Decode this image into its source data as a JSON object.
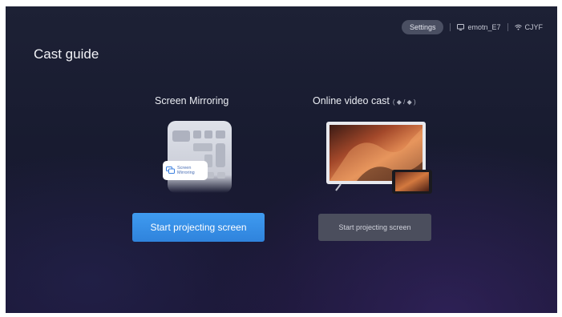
{
  "page": {
    "title": "Cast guide"
  },
  "topbar": {
    "settings_label": "Settings",
    "device_name": "emotn_E7",
    "wifi_name": "CJYF",
    "device_icon": "monitor-icon",
    "wifi_icon": "wifi-icon"
  },
  "options": [
    {
      "label": "Screen Mirroring",
      "illustration_badge": "Screen Mirroring",
      "button_label": "Start projecting screen",
      "focused": true
    },
    {
      "label": "Online video cast",
      "platform_icons": "( ◆ / ◆ )",
      "button_label": "Start projecting screen",
      "focused": false
    }
  ],
  "colors": {
    "primary_button": "#3a93ea",
    "secondary_button": "#4b4e5d",
    "background": "#1c2034"
  }
}
